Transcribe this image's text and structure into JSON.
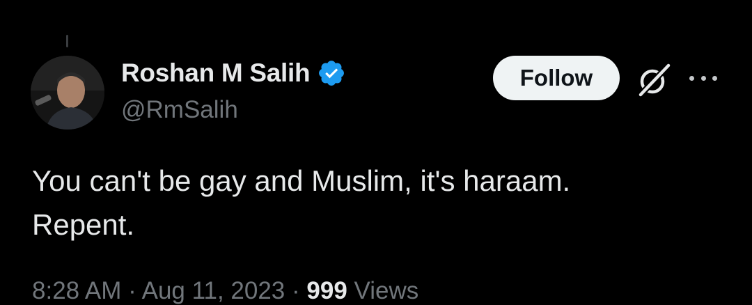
{
  "tweet": {
    "author": {
      "display_name": "Roshan M Salih",
      "handle": "@RmSalih",
      "verified": true,
      "verified_color": "#1d9bf0"
    },
    "follow_label": "Follow",
    "text_line1": "You can't be gay and Muslim, it's haraam.",
    "text_line2": "Repent.",
    "time": "8:28 AM",
    "separator": "·",
    "date": "Aug 11, 2023",
    "views_count": "999",
    "views_label": "Views"
  },
  "icons": {
    "verified": "verified-badge-icon",
    "grok": "grok-icon",
    "more": "more-options-icon"
  },
  "colors": {
    "background": "#000000",
    "primary_text": "#e7e9ea",
    "secondary_text": "#71767b",
    "button_bg": "#eff3f4",
    "button_text": "#0f1419"
  }
}
